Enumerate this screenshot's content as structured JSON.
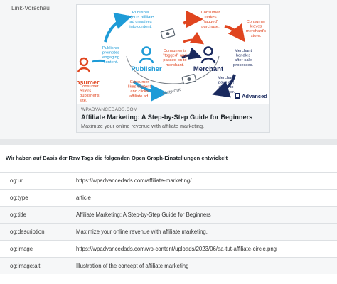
{
  "preview": {
    "label": "Link-Vorschau",
    "card": {
      "domain": "WPADVANCEDADS.COM",
      "title": "Affiliate Marketing: A Step-by-Step Guide for Beginners",
      "description": "Maximize your online revenue with affiliate marketing."
    },
    "diagram": {
      "nodes": {
        "publisher": "Publisher",
        "merchant": "Merchant",
        "consumer": "nsumer",
        "network": "Network"
      },
      "logo": "Advanced",
      "steps": {
        "publisher_injects": [
          "Publisher",
          "injects affiliate",
          "ad creatives",
          "into content."
        ],
        "consumer_tagged_purchase": [
          "Consumer",
          "makes",
          "\"tagged\"",
          "purchase."
        ],
        "consumer_leaves": [
          "Consumer",
          "leaves",
          "merchant's",
          "store."
        ],
        "publisher_promotes": [
          "Publisher",
          "promotes",
          "engaging",
          "content."
        ],
        "consumer_tagged_passed": [
          "Consumer is",
          "\"tagged\" and",
          "passed on to",
          "merchant."
        ],
        "merchant_handles": [
          "Merchant",
          "handles",
          "after-sale",
          "processes."
        ],
        "consumer_enters": [
          "Consumer",
          "enters",
          "publisher's",
          "site."
        ],
        "consumer_likes": [
          "Consumer",
          "likes content",
          "and clicks",
          "affiliate ad."
        ],
        "merchant_pays": [
          "Merchant",
          "pays out",
          "share to",
          "publisher."
        ]
      },
      "colors": {
        "blue": "#1e9bd7",
        "red": "#e0451f",
        "navy": "#1a2a5e",
        "grey": "#5a6570"
      }
    }
  },
  "og_section": {
    "heading": "Wir haben auf Basis der Raw Tags die folgenden Open Graph-Einstellungen entwickelt",
    "rows": [
      {
        "key": "og:url",
        "value": "https://wpadvancedads.com/affiliate-marketing/"
      },
      {
        "key": "og:type",
        "value": "article"
      },
      {
        "key": "og:title",
        "value": "Affiliate Marketing: A Step-by-Step Guide for Beginners"
      },
      {
        "key": "og:description",
        "value": "Maximize your online revenue with affiliate marketing."
      },
      {
        "key": "og:image",
        "value": "https://wpadvancedads.com/wp-content/uploads/2023/06/aa-tut-affiliate-circle.png"
      },
      {
        "key": "og:image:alt",
        "value": "Illustration of the concept of affiliate marketing"
      }
    ]
  }
}
